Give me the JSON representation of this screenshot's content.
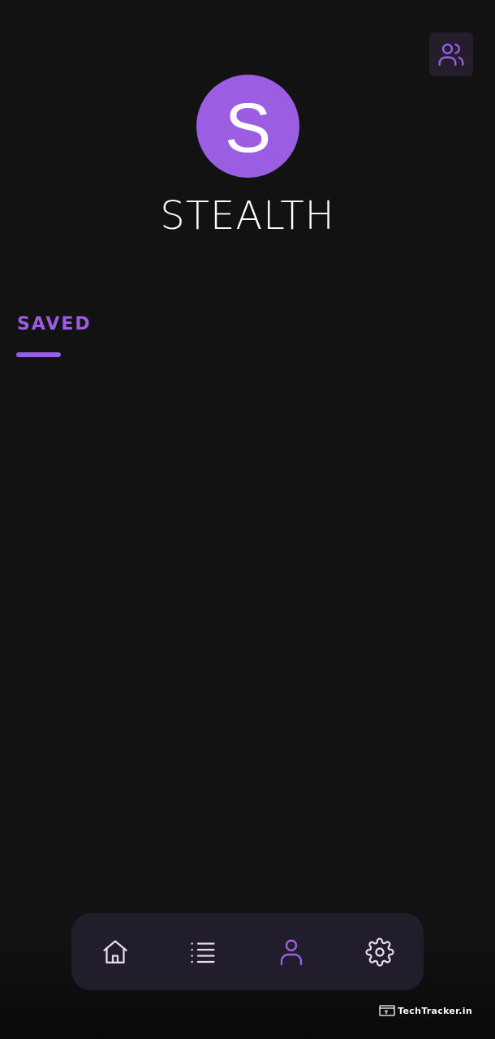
{
  "header": {
    "friends_icon": "users-icon"
  },
  "profile": {
    "avatar_letter": "S",
    "avatar_color": "#9b5ee3",
    "username": "STEALTH"
  },
  "tabs": [
    {
      "label": "SAVED",
      "active": true
    }
  ],
  "bottom_nav": {
    "items": [
      {
        "icon": "home-icon",
        "active": false
      },
      {
        "icon": "list-icon",
        "active": false
      },
      {
        "icon": "user-icon",
        "active": true
      },
      {
        "icon": "gear-icon",
        "active": false
      }
    ],
    "active_color": "#9b5ee3",
    "inactive_color": "#e6dcf3"
  },
  "watermark": {
    "text": "TechTracker.in"
  },
  "theme": {
    "background": "#121212",
    "accent": "#9b5ee3",
    "nav_background": "#221d2b"
  }
}
